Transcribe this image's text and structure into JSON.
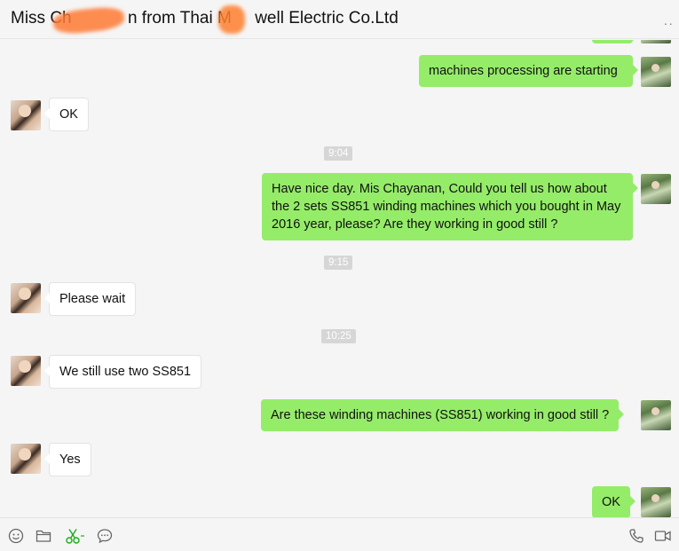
{
  "header": {
    "title": "Miss Ch            n from Thai M     well Electric Co.Ltd",
    "more_label": "··"
  },
  "messages": [
    {
      "side": "out",
      "text": "machines processing are starting"
    },
    {
      "side": "in",
      "text": "OK"
    },
    {
      "time": "9:04"
    },
    {
      "side": "out",
      "text": "Have nice day. Mis Chayanan, Could you tell us how about the 2 sets SS851 winding machines which you bought in May 2016 year, please? Are they working in good still ?"
    },
    {
      "time": "9:15"
    },
    {
      "side": "in",
      "text": "Please wait"
    },
    {
      "time": "10:25"
    },
    {
      "side": "in",
      "text": "We still use two SS851"
    },
    {
      "side": "out",
      "text": "Are these winding machines (SS851) working in good still ?"
    },
    {
      "side": "in",
      "text": "Yes"
    },
    {
      "side": "out",
      "text": "OK"
    }
  ],
  "toolbar": {
    "left": [
      "emoji-icon",
      "folder-icon",
      "scissors-icon",
      "chat-history-icon"
    ],
    "right": [
      "phone-icon",
      "video-icon"
    ]
  },
  "colors": {
    "out_bubble": "#95ec69",
    "in_bubble": "#ffffff",
    "background": "#f5f5f5",
    "time_badge": "#d6d6d6",
    "scissors": "#1aad19"
  }
}
